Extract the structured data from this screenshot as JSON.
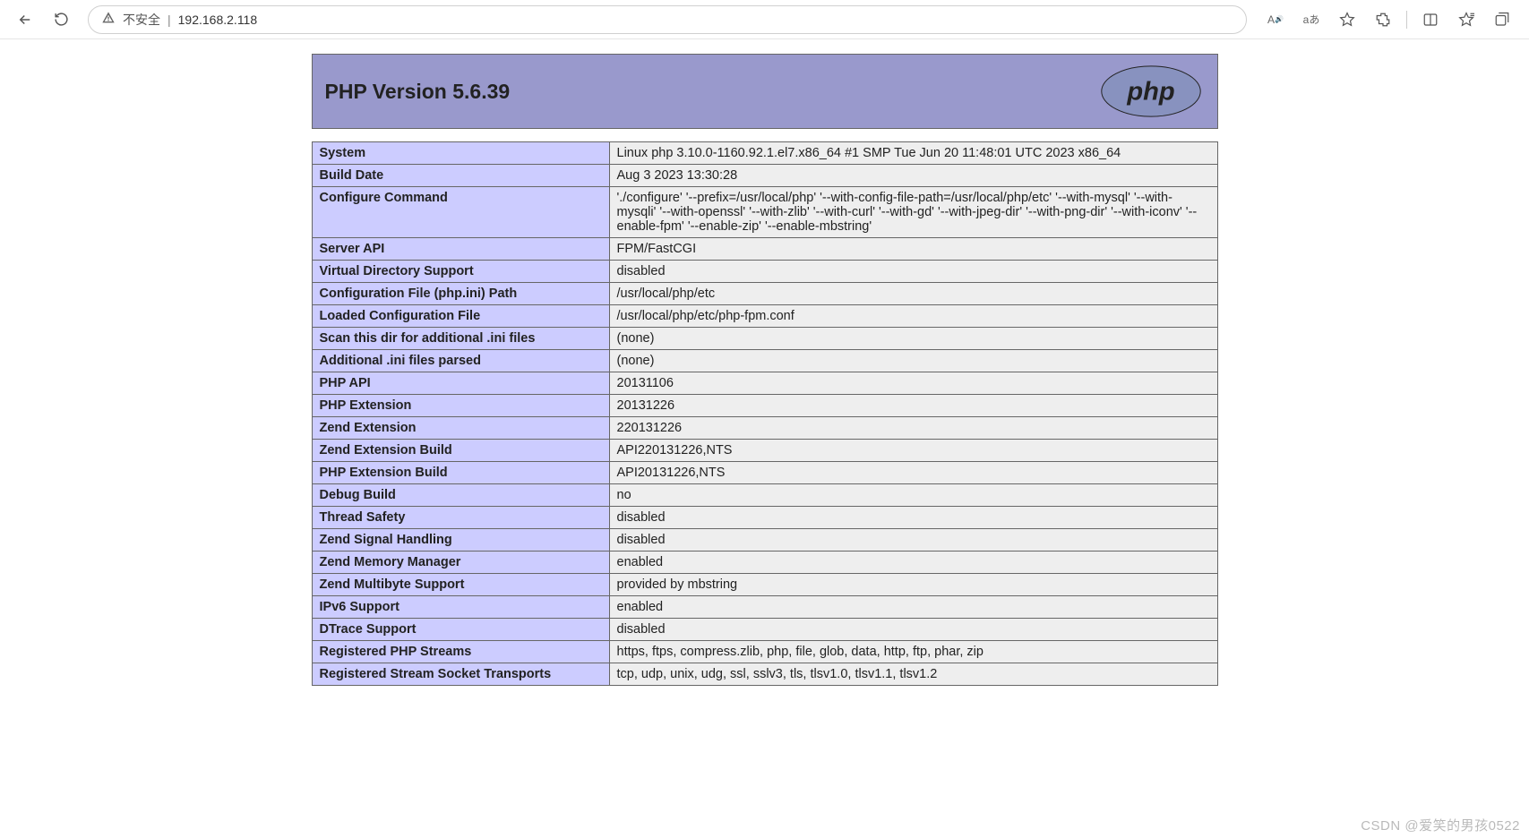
{
  "browser": {
    "insecure_label": "不安全",
    "url": "192.168.2.118"
  },
  "page": {
    "title": "PHP Version 5.6.39",
    "rows": [
      {
        "k": "System",
        "v": "Linux php 3.10.0-1160.92.1.el7.x86_64 #1 SMP Tue Jun 20 11:48:01 UTC 2023 x86_64"
      },
      {
        "k": "Build Date",
        "v": "Aug 3 2023 13:30:28"
      },
      {
        "k": "Configure Command",
        "v": "'./configure' '--prefix=/usr/local/php' '--with-config-file-path=/usr/local/php/etc' '--with-mysql' '--with-mysqli' '--with-openssl' '--with-zlib' '--with-curl' '--with-gd' '--with-jpeg-dir' '--with-png-dir' '--with-iconv' '--enable-fpm' '--enable-zip' '--enable-mbstring'"
      },
      {
        "k": "Server API",
        "v": "FPM/FastCGI"
      },
      {
        "k": "Virtual Directory Support",
        "v": "disabled"
      },
      {
        "k": "Configuration File (php.ini) Path",
        "v": "/usr/local/php/etc"
      },
      {
        "k": "Loaded Configuration File",
        "v": "/usr/local/php/etc/php-fpm.conf"
      },
      {
        "k": "Scan this dir for additional .ini files",
        "v": "(none)"
      },
      {
        "k": "Additional .ini files parsed",
        "v": "(none)"
      },
      {
        "k": "PHP API",
        "v": "20131106"
      },
      {
        "k": "PHP Extension",
        "v": "20131226"
      },
      {
        "k": "Zend Extension",
        "v": "220131226"
      },
      {
        "k": "Zend Extension Build",
        "v": "API220131226,NTS"
      },
      {
        "k": "PHP Extension Build",
        "v": "API20131226,NTS"
      },
      {
        "k": "Debug Build",
        "v": "no"
      },
      {
        "k": "Thread Safety",
        "v": "disabled"
      },
      {
        "k": "Zend Signal Handling",
        "v": "disabled"
      },
      {
        "k": "Zend Memory Manager",
        "v": "enabled"
      },
      {
        "k": "Zend Multibyte Support",
        "v": "provided by mbstring"
      },
      {
        "k": "IPv6 Support",
        "v": "enabled"
      },
      {
        "k": "DTrace Support",
        "v": "disabled"
      },
      {
        "k": "Registered PHP Streams",
        "v": "https, ftps, compress.zlib, php, file, glob, data, http, ftp, phar, zip"
      },
      {
        "k": "Registered Stream Socket Transports",
        "v": "tcp, udp, unix, udg, ssl, sslv3, tls, tlsv1.0, tlsv1.1, tlsv1.2"
      }
    ]
  },
  "watermark": "CSDN @爱笑的男孩0522"
}
